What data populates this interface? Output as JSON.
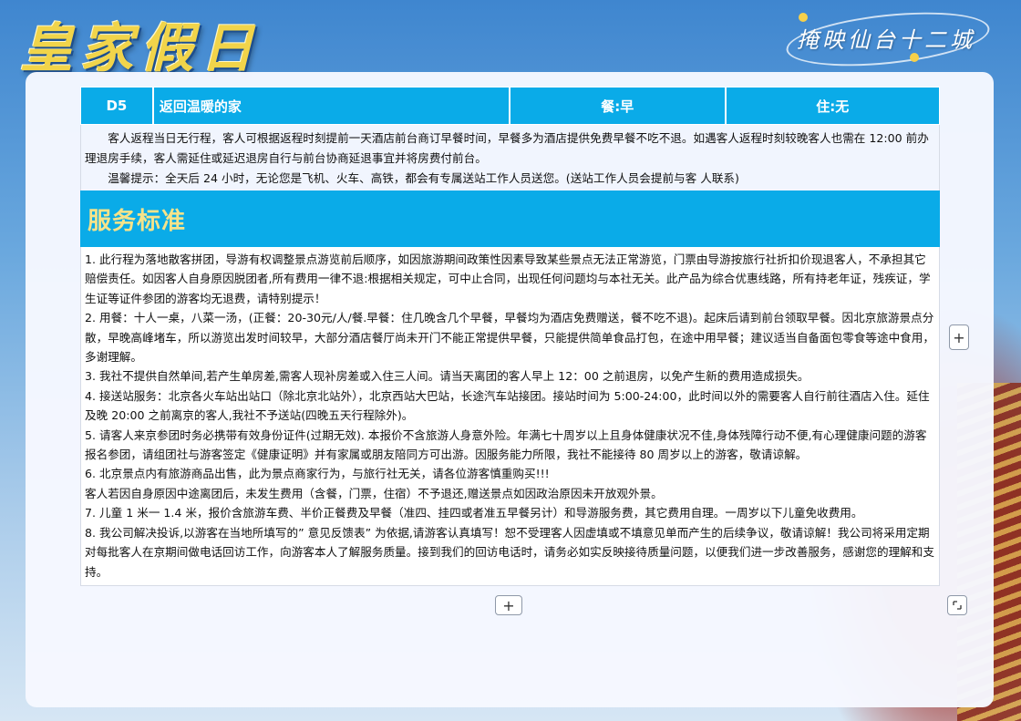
{
  "header": {
    "logo_text": "皇家假日",
    "slogan": "掩映仙台十二城"
  },
  "day": {
    "number": "D5",
    "title": "返回温暖的家",
    "meal": "餐:早",
    "stay": "住:无"
  },
  "day_text": {
    "p1": "客人返程当日无行程，客人可根据返程时刻提前一天酒店前台商订早餐时间，早餐多为酒店提供免费早餐不吃不退。如遇客人返程时刻较晚客人也需在 12:00 前办理退房手续，客人需延住或延迟退房自行与前台协商延退事宜并将房费付前台。",
    "p2": "温馨提示：全天后 24 小时，无论您是飞机、火车、高铁，都会有专属送站工作人员送您。(送站工作人员会提前与客 人联系)"
  },
  "service": {
    "title": "服务标准",
    "items": [
      "1. 此行程为落地散客拼团，导游有权调整景点游览前后顺序，如因旅游期间政策性因素导致某些景点无法正常游览，门票由导游按旅行社折扣价现退客人，不承担其它赔偿责任。如因客人自身原因脱团者,所有费用一律不退:根据相关规定，可中止合同，出现任何问题均与本社无关。此产品为综合优惠线路，所有持老年证，残疾证，学生证等证件参团的游客均无退费，请特别提示！",
      "2. 用餐：十人一桌，八菜一汤，(正餐：20-30元/人/餐.早餐：住几晚含几个早餐，早餐均为酒店免费赠送，餐不吃不退)。起床后请到前台领取早餐。因北京旅游景点分散，早晚高峰堵车，所以游览出发时间较早，大部分酒店餐厅尚未开门不能正常提供早餐，只能提供简单食品打包，在途中用早餐；建议适当自备面包零食等途中食用，多谢理解。",
      "3. 我社不提供自然单间,若产生单房差,需客人现补房差或入住三人间。请当天离团的客人早上 12：00 之前退房，以免产生新的费用造成损失。",
      "4. 接送站服务：北京各火车站出站口（除北京北站外），北京西站大巴站，长途汽车站接团。接站时间为 5:00-24:00，此时间以外的需要客人自行前往酒店入住。延住及晚 20:00 之前离京的客人,我社不予送站(四晚五天行程除外)。",
      "5. 请客人来京参团时务必携带有效身份证件(过期无效). 本报价不含旅游人身意外险。年满七十周岁以上且身体健康状况不佳,身体残障行动不便,有心理健康问题的游客报名参团，请组团社与游客签定《健康证明》并有家属或朋友陪同方可出游。因服务能力所限，我社不能接待 80 周岁以上的游客，敬请谅解。",
      "6. 北京景点内有旅游商品出售，此为景点商家行为，与旅行社无关，请各位游客慎重购买!!!",
      "客人若因自身原因中途离团后，未发生费用（含餐，门票，住宿）不予退还,赠送景点如因政治原因未开放观外景。",
      "7. 儿童 1 米一 1.4 米，报价含旅游车费、半价正餐费及早餐（准四、挂四或者准五早餐另计）和导游服务费，其它费用自理。一周岁以下儿童免收费用。",
      "8. 我公司解决投诉,以游客在当地所填写的” 意见反馈表” 为依据,请游客认真填写！恕不受理客人因虚填或不填意见单而产生的后续争议，敬请谅解！我公司将采用定期对每批客人在京期间做电话回访工作，向游客本人了解服务质量。接到我们的回访电话时，请务必如实反映接待质量问题，以便我们进一步改善服务，感谢您的理解和支持。"
    ]
  },
  "controls": {
    "plus_symbol": "+",
    "corner_symbol": "⌐¬"
  }
}
